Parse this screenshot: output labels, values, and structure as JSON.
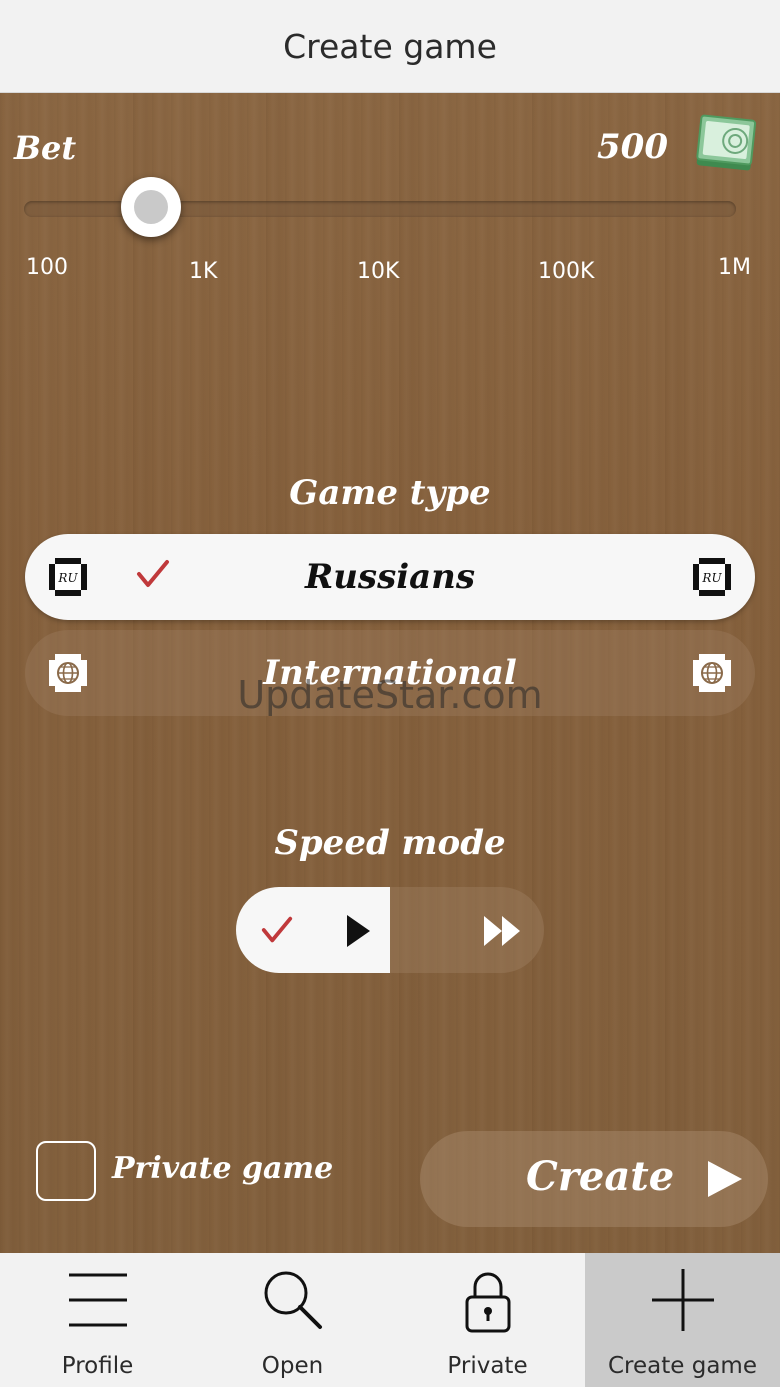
{
  "header": {
    "title": "Create game"
  },
  "bet": {
    "label": "Bet",
    "value": "500",
    "slider_ticks": [
      "100",
      "1K",
      "10K",
      "100K",
      "1M"
    ],
    "slider_value": "500",
    "money_icon": "money-icon"
  },
  "game_type": {
    "title": "Game type",
    "options": [
      {
        "label": "Russians",
        "selected": true,
        "icon": "ru-badge-icon"
      },
      {
        "label": "International",
        "selected": false,
        "icon": "globe-icon"
      }
    ]
  },
  "speed_mode": {
    "title": "Speed mode",
    "options": [
      {
        "icon": "play-icon",
        "selected": true
      },
      {
        "icon": "fast-forward-icon",
        "selected": false
      }
    ]
  },
  "private_game": {
    "label": "Private game",
    "checked": false
  },
  "create_button": {
    "label": "Create"
  },
  "watermark": "UpdateStar.com",
  "nav": {
    "items": [
      {
        "label": "Profile",
        "icon": "menu-icon",
        "active": false
      },
      {
        "label": "Open",
        "icon": "search-icon",
        "active": false
      },
      {
        "label": "Private",
        "icon": "lock-icon",
        "active": false
      },
      {
        "label": "Create game",
        "icon": "plus-icon",
        "active": true
      }
    ]
  },
  "colors": {
    "wood": "#86613d",
    "check": "#c0393b",
    "active_tab": "#cacaca"
  }
}
